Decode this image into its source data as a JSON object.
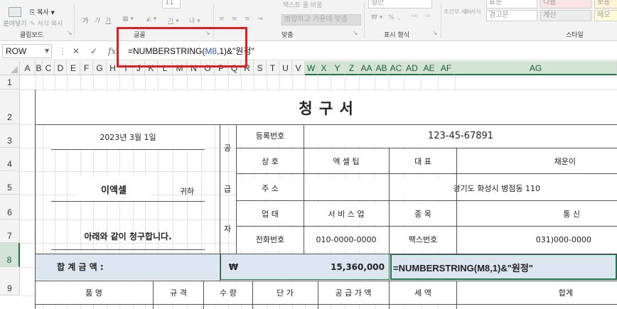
{
  "ribbon": {
    "faded_top": [
      "붙여넣기",
      "복사",
      "서식 복사",
      "가",
      "가",
      "가",
      "11",
      "텍스트 줄 바꿈",
      "일반",
      "표준",
      "나쁨",
      "보통"
    ],
    "clipboard": {
      "paste": "붙여넣기",
      "copy": "복사",
      "format_painter": "서식 복사",
      "group_label": "클립보드"
    },
    "font": {
      "bold": "가",
      "italic": "가",
      "underline": "가",
      "group_label": "글꼴"
    },
    "alignment": {
      "wrap": "텍스트 줄 바꿈",
      "merge": "병합하고 가운데 맞춤",
      "group_label": "맞춤"
    },
    "number": {
      "format_value": "일반",
      "percent": "%",
      "comma": ",",
      "group_label": "표시 형식"
    },
    "styles": {
      "conditional": "조건부 서식",
      "table": "표 서식",
      "normal": "표준",
      "bad": "나쁨",
      "neutral": "보통",
      "warning": "경고문",
      "calc": "계산",
      "memo": "메모",
      "group_label": "스타일"
    }
  },
  "formula_bar": {
    "name_box": "ROW",
    "formula_prefix": "=NUMBERSTRING(",
    "formula_ref": "M8",
    "formula_suffix": ",1)&\"원정\""
  },
  "columns": [
    "A",
    "B",
    "C",
    "D",
    "E",
    "F",
    "G",
    "H",
    "I",
    "J",
    "K",
    "L",
    "M",
    "N",
    "O",
    "P",
    "Q",
    "R",
    "S",
    "T",
    "U",
    "V",
    "W",
    "X",
    "Y",
    "Z",
    "AA",
    "AB",
    "AC",
    "AD",
    "AE",
    "AF",
    "AG"
  ],
  "rows": [
    "1",
    "2",
    "3",
    "4",
    "5",
    "6",
    "7",
    "8",
    "9"
  ],
  "invoice": {
    "title": "청 구 서",
    "date": "2023년 3월 1일",
    "customer": "이엑셀",
    "honorific": "귀하",
    "message": "아래와 같이 청구합니다.",
    "supplier_label": [
      "공",
      "급",
      "자"
    ],
    "reg_label": "등록번호",
    "reg_value": "123-45-67891",
    "name_label": "상      호",
    "name_value": "엑    셀    팁",
    "rep_label": "대      표",
    "rep_value": "채운이",
    "addr_label": "주      소",
    "addr_value": "경기도 화성시 병점동 110",
    "biz_label": "업      태",
    "biz_value": "서  비  스  업",
    "type_label": "종      목",
    "type_value": "통      신",
    "phone_label": "전화번호",
    "phone_value": "010-0000-0000",
    "fax_label": "팩스번호",
    "fax_value": "031)000-0000",
    "total_label": "합      계      금      액      :",
    "total_currency": "₩",
    "total_amount": "15,360,000",
    "total_formula": "=NUMBERSTRING(M8,1)&\"원정\"",
    "col_item": "품                  명",
    "col_spec": "규    격",
    "col_qty": "수    량",
    "col_price": "단              가",
    "col_supply": "공 급 가 액",
    "col_tax": "세          액",
    "col_total": "합계"
  }
}
